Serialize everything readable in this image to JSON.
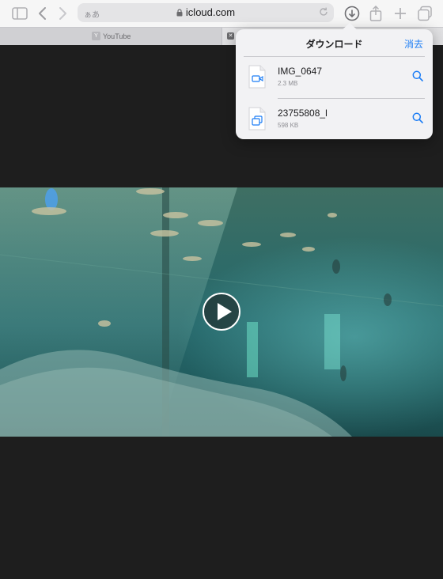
{
  "browser": {
    "address_prefix": "ぁあ",
    "url": "icloud.com"
  },
  "tabs": [
    {
      "title": "YouTube",
      "favicon": "Y"
    },
    {
      "title": ""
    }
  ],
  "downloads": {
    "title": "ダウンロード",
    "clear_label": "消去",
    "items": [
      {
        "name": "IMG_0647",
        "size": "2.3 MB",
        "icon": "video-camera-icon"
      },
      {
        "name": "23755808_l",
        "size": "598 KB",
        "icon": "photos-icon"
      }
    ]
  },
  "colors": {
    "accent": "#1a7cf5",
    "background": "#1e1e1e",
    "toolbar": "#f6f6f6"
  }
}
